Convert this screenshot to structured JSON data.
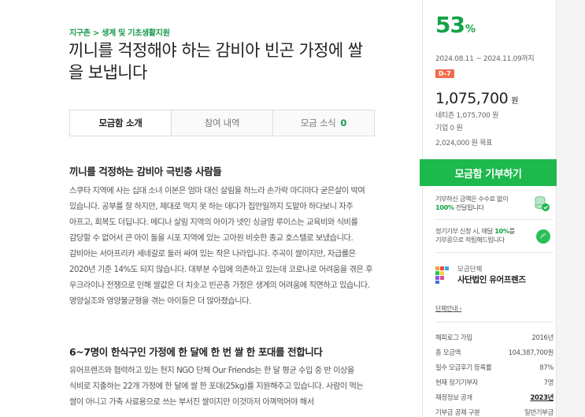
{
  "campaign": {
    "category": "지구촌 > 생계 및 기초생활지원",
    "title": "끼니를 걱정해야 하는 감비아 빈곤 가정에 쌀을 보냅니다"
  },
  "tabs": [
    {
      "label": "모금함 소개",
      "active": true
    },
    {
      "label": "참여 내역",
      "active": false
    },
    {
      "label": "모금 소식",
      "count": "0",
      "active": false
    }
  ],
  "content": {
    "section1_title": "끼니를 걱정하는 감비아 극빈층 사람들",
    "section1_body": "스쿠타 지역에 사는 십대 소녀 이본은 엄마 대신 살림을 하느라 손가락 마디마다 굳은살이 박여 있습니다. 공부를 잘 하지만, 제대로 먹지 못 하는 데다가 집안일까지 도맡아 하다보니 자주 아프고, 회복도 더딥니다. 메디나 살림 지역의 아이가 넷인 싱글맘 루이스는 교육비와 식비를 감당할 수 없어서 큰 아이 둘을 시포 지역에 있는 고아원 비슷한 종교 호스텔로 보냈습니다. 감비아는 서아프리카 세네갈로 둘러 싸여 있는 작은 나라입니다. 주곡이 쌀이지만, 자급률은 2020년 기준 14%도 되지 않습니다. 대부분 수입에 의존하고 있는데 코로나로 어려움을 겪은 후 우크라이나 전쟁으로 인해 쌀값은 더 치솟고 빈곤층 가정은 생계의 어려움에 직면하고 있습니다. 영양실조와 영양불균형을 겪는 아이들은 더 많아졌습니다.",
    "section2_title": "6~7명이 한식구인 가정에 한 달에 한 번 쌀 한 포대를 전합니다",
    "section2_body": "유어프렌즈와 협력하고 있는 현지 NGO 단체 Our Friends는 한 달 평균 수입 중 반 이상을 식비로 지출하는 22개 가정에 한 달에 쌀 한 포대(25kg)를 지원해주고 있습니다. 사람이 먹는 쌀이 아니고 가축 사료용으로 쓰는 부서진 쌀이지만 이것마저 아껴먹어야 해서"
  },
  "summary": {
    "percent": "53",
    "percent_unit": "%",
    "period": "2024.08.11 ~ 2024.11.09까지",
    "dday": "D-7",
    "amount": "1,075,700",
    "amount_unit": "원",
    "netizen": "네티즌 1,075,700 원",
    "corp": "기업 0 원",
    "goal": "2,024,000 원 목표",
    "donate_button": "모금함 기부하기"
  },
  "notices": {
    "fee_line1": "기부하신 금액은 수수료 없이",
    "fee_hl": "100%",
    "fee_line2": "전달됩니다",
    "regular_line1": "정기기부 신청 시, 매달",
    "regular_hl": "10%",
    "regular_line1b": "를",
    "regular_line2": "기부콩으로 적립해드립니다"
  },
  "org": {
    "label": "모금단체",
    "name": "사단법인 유어프렌즈",
    "link": "단체안내 ›"
  },
  "stats": [
    {
      "label": "해피로그 가입",
      "value": "2016년"
    },
    {
      "label": "총 모금액",
      "value": "104,387,700원"
    },
    {
      "label": "필수 모금후기 등록률",
      "value": "87%"
    },
    {
      "label": "현재 정기기부자",
      "value": "7명"
    },
    {
      "label": "재정정보 공개",
      "value": "2023년",
      "underline": true
    },
    {
      "label": "기부금 공제 구분",
      "value": "일반기부금"
    }
  ],
  "colors": {
    "brand_green": "#1db94c",
    "percent_green": "#12a346",
    "dday_red": "#f26b4c"
  }
}
